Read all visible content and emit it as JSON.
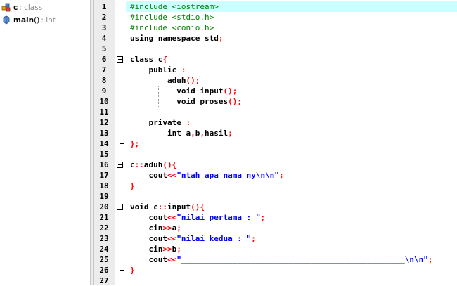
{
  "class_browser": {
    "items": [
      {
        "name": "c",
        "type": ": class",
        "icon": "class-icon"
      },
      {
        "name": "main",
        "paren": "()",
        "type": ": int",
        "icon": "function-icon"
      }
    ]
  },
  "editor": {
    "line_numbers": [
      "1",
      "2",
      "3",
      "4",
      "5",
      "6",
      "7",
      "8",
      "9",
      "10",
      "11",
      "12",
      "13",
      "14",
      "15",
      "16",
      "17",
      "18",
      "19",
      "20",
      "21",
      "22",
      "23",
      "24",
      "25",
      "26",
      "27"
    ],
    "highlighted_line": 1,
    "lines": [
      {
        "parts": [
          {
            "t": "#include <iostream>",
            "c": "pp"
          }
        ]
      },
      {
        "parts": [
          {
            "t": "#include <stdio.h>",
            "c": "pp"
          }
        ]
      },
      {
        "parts": [
          {
            "t": "#include <conio.h>",
            "c": "pp"
          }
        ]
      },
      {
        "parts": [
          {
            "t": "using namespace std",
            "c": "plain"
          },
          {
            "t": ";",
            "c": "sym"
          }
        ]
      },
      {
        "parts": []
      },
      {
        "parts": [
          {
            "t": "class c",
            "c": "plain"
          },
          {
            "t": "{",
            "c": "sym"
          }
        ]
      },
      {
        "parts": [
          {
            "t": "    public ",
            "c": "plain"
          },
          {
            "t": ":",
            "c": "sym"
          }
        ]
      },
      {
        "parts": [
          {
            "t": "        aduh",
            "c": "plain"
          },
          {
            "t": "();",
            "c": "sym"
          }
        ]
      },
      {
        "parts": [
          {
            "t": "          void input",
            "c": "plain"
          },
          {
            "t": "();",
            "c": "sym"
          }
        ]
      },
      {
        "parts": [
          {
            "t": "          void proses",
            "c": "plain"
          },
          {
            "t": "();",
            "c": "sym"
          }
        ]
      },
      {
        "parts": []
      },
      {
        "parts": [
          {
            "t": "    private ",
            "c": "plain"
          },
          {
            "t": ":",
            "c": "sym"
          }
        ]
      },
      {
        "parts": [
          {
            "t": "        int a",
            "c": "plain"
          },
          {
            "t": ",",
            "c": "sym"
          },
          {
            "t": "b",
            "c": "plain"
          },
          {
            "t": ",",
            "c": "sym"
          },
          {
            "t": "hasil",
            "c": "plain"
          },
          {
            "t": ";",
            "c": "sym"
          }
        ]
      },
      {
        "parts": [
          {
            "t": "};",
            "c": "sym"
          }
        ]
      },
      {
        "parts": []
      },
      {
        "parts": [
          {
            "t": "c",
            "c": "plain"
          },
          {
            "t": "::",
            "c": "sym"
          },
          {
            "t": "aduh",
            "c": "plain"
          },
          {
            "t": "(){",
            "c": "sym"
          }
        ]
      },
      {
        "parts": [
          {
            "t": "    cout",
            "c": "plain"
          },
          {
            "t": "<<",
            "c": "sym"
          },
          {
            "t": "\"ntah apa nama ny\\n\\n\"",
            "c": "str"
          },
          {
            "t": ";",
            "c": "sym"
          }
        ]
      },
      {
        "parts": [
          {
            "t": "}",
            "c": "sym"
          }
        ]
      },
      {
        "parts": []
      },
      {
        "parts": [
          {
            "t": "void c",
            "c": "plain"
          },
          {
            "t": "::",
            "c": "sym"
          },
          {
            "t": "input",
            "c": "plain"
          },
          {
            "t": "(){",
            "c": "sym"
          }
        ]
      },
      {
        "parts": [
          {
            "t": "    cout",
            "c": "plain"
          },
          {
            "t": "<<",
            "c": "sym"
          },
          {
            "t": "\"nilai pertama : \"",
            "c": "str"
          },
          {
            "t": ";",
            "c": "sym"
          }
        ]
      },
      {
        "parts": [
          {
            "t": "    cin",
            "c": "plain"
          },
          {
            "t": ">>",
            "c": "sym"
          },
          {
            "t": "a",
            "c": "plain"
          },
          {
            "t": ";",
            "c": "sym"
          }
        ]
      },
      {
        "parts": [
          {
            "t": "    cout",
            "c": "plain"
          },
          {
            "t": "<<",
            "c": "sym"
          },
          {
            "t": "\"nilai kedua : \"",
            "c": "str"
          },
          {
            "t": ";",
            "c": "sym"
          }
        ]
      },
      {
        "parts": [
          {
            "t": "    cin",
            "c": "plain"
          },
          {
            "t": ">>",
            "c": "sym"
          },
          {
            "t": "b",
            "c": "plain"
          },
          {
            "t": ";",
            "c": "sym"
          }
        ]
      },
      {
        "parts": [
          {
            "t": "    cout",
            "c": "plain"
          },
          {
            "t": "<<",
            "c": "sym"
          },
          {
            "t": "\"________________________________________________\\n\\n\"",
            "c": "str"
          },
          {
            "t": ";",
            "c": "sym"
          }
        ]
      },
      {
        "parts": [
          {
            "t": "}",
            "c": "sym"
          }
        ]
      },
      {
        "parts": []
      }
    ]
  },
  "colors": {
    "highlight": "#ccffff",
    "preprocessor": "#008000",
    "symbol": "#ff0000",
    "string": "#0000ff"
  }
}
